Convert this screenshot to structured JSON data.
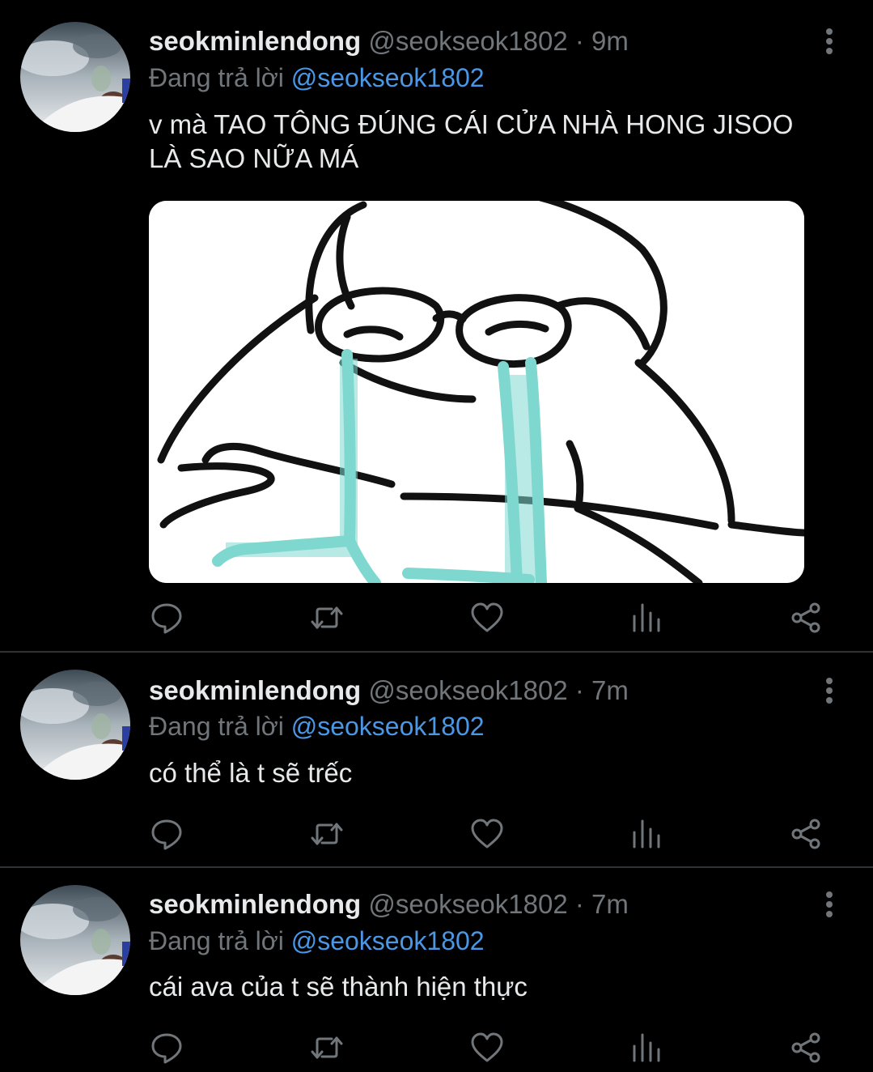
{
  "tweets": [
    {
      "display_name": "seokminlendong",
      "handle": "@seokseok1802",
      "separator": "·",
      "time": "9m",
      "reply_prefix": "Đang trả lời",
      "reply_to": "@seokseok1802",
      "text_line1": "v mà TAO TÔNG ĐÚNG CÁI CỬA NHÀ HONG JISOO",
      "text_line2": "LÀ SAO NỮA MÁ",
      "has_media": true
    },
    {
      "display_name": "seokminlendong",
      "handle": "@seokseok1802",
      "separator": "·",
      "time": "7m",
      "reply_prefix": "Đang trả lời",
      "reply_to": "@seokseok1802",
      "text_line1": "có thể là t sẽ trếc",
      "has_media": false
    },
    {
      "display_name": "seokminlendong",
      "handle": "@seokseok1802",
      "separator": "·",
      "time": "7m",
      "reply_prefix": "Đang trả lời",
      "reply_to": "@seokseok1802",
      "text_line1": "cái ava của t sẽ thành hiện thực",
      "has_media": false
    }
  ],
  "icons": {
    "more": "more-vertical-icon",
    "reply": "reply-icon",
    "retweet": "retweet-icon",
    "like": "heart-icon",
    "views": "views-icon",
    "share": "share-icon"
  },
  "colors": {
    "background": "#000000",
    "text": "#e7e9ea",
    "muted": "#71767b",
    "link": "#4a97e6",
    "divider": "#2f3336",
    "tears": "#7fd8cf"
  }
}
